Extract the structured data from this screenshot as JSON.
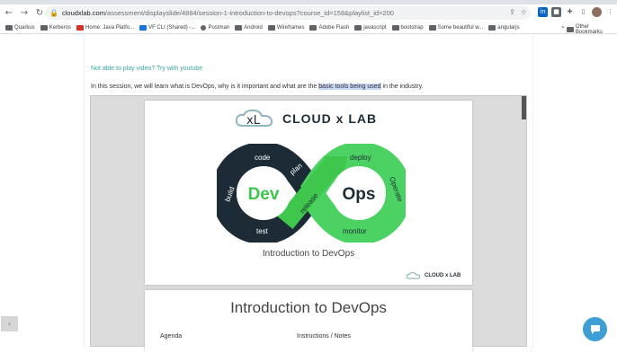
{
  "browser": {
    "url_host": "cloudxlab.com",
    "url_path": "/assessment/displayslide/4884/session-1-introduction-to-devops?course_id=158&playlist_id=200",
    "bookmarks": [
      "Quarkus",
      "Kerberos",
      "Home: Java Platfo...",
      "VF CLI (Shared) -...",
      "Postman",
      "Android",
      "Wireframes",
      "Adobe Flash",
      "javascript",
      "bootstrap",
      "Some beautiful w...",
      "angularjs"
    ],
    "other_bookmarks": "Other Bookmarks"
  },
  "page": {
    "youtube_link": "Not able to play video? Try with youtube",
    "intro_before": "In this session, we will learn what is DevOps, why is it important and what are the ",
    "intro_highlight": "basic tools being used",
    "intro_after": " in the industry."
  },
  "slide1": {
    "brand": "CLOUD x LAB",
    "dev": "Dev",
    "ops": "Ops",
    "loop_labels": [
      "code",
      "build",
      "test",
      "plan",
      "release",
      "deploy",
      "Operate",
      "monitor"
    ],
    "caption": "Introduction to DevOps",
    "footer_brand": "CLOUD x LAB"
  },
  "slide2": {
    "title": "Introduction to DevOps",
    "agenda": "Agenda",
    "notes": "Instructions / Notes"
  },
  "colors": {
    "brand_dark": "#1d2b36",
    "devops_green": "#3ec74c",
    "link_teal": "#3aa6a0",
    "chat_blue": "#3f9ed6"
  }
}
